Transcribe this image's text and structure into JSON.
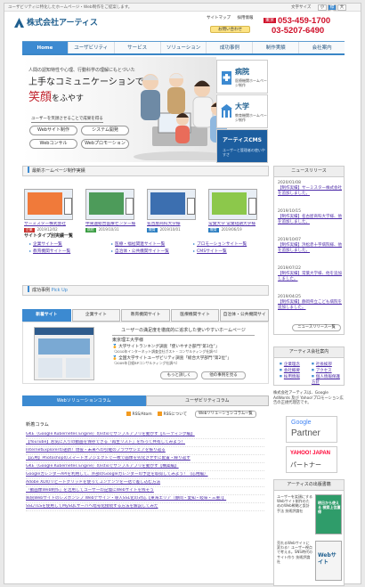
{
  "header": {
    "tagline": "ユーザビリティに特化したホームページ・Web制作をご提案します。",
    "font_size_label": "文字サイズ",
    "font_sizes": [
      "小",
      "標準",
      "大"
    ],
    "logo_text": "株式会社アーティス",
    "links": [
      "サイトマップ",
      "採用情報"
    ],
    "billing_button": "お問い合わせ",
    "tel_tokyo_label": "東京",
    "tel_tokyo": "053-459-1700",
    "tel_other": "03-5207-6490"
  },
  "nav": {
    "items": [
      "Home",
      "ユーザビリティ",
      "サービス",
      "ソリューション",
      "成功事例",
      "制作実績",
      "会社案内"
    ],
    "active": 0
  },
  "hero": {
    "subtitle": "人間の認知特性や心理、行動科学の理解にもとづいた",
    "title_line1": "上手なコミュニケーションで",
    "title_big": "笑顔",
    "title_tail": "をふやす",
    "note": "ユーザーを笑顔させることで成果を得る",
    "buttons": [
      "Webサイト制作",
      "システム開発",
      "Webコンサル",
      "Webプロモーション"
    ]
  },
  "banners": [
    {
      "title": "病院",
      "sub": "医療機関ホームページ制作"
    },
    {
      "title": "大学",
      "sub": "教育機関ホームページ制作"
    },
    {
      "title": "アーティスCMS",
      "sub": "ユーザーと管理者の使いやすさ"
    }
  ],
  "works": {
    "section_title": "最新ホームページ制作実績",
    "items": [
      {
        "name": "サーミスター株式会社",
        "tag": "企業",
        "date": "2019/12/02"
      },
      {
        "name": "中東遠総合医療センター様",
        "tag": "病院",
        "date": "2019/10/31"
      },
      {
        "name": "名古屋商科大学様",
        "tag": "教育",
        "date": "2019/10/01"
      },
      {
        "name": "常葉大学 常葉短期大学様",
        "tag": "教育",
        "date": "2019/06/19"
      }
    ],
    "tag_colors": {
      "企業": "#c9302c",
      "病院": "#3a9d43",
      "教育": "#2d7fc2"
    },
    "kind_title": "サイトタイプ別実績一覧",
    "kinds": [
      "企業サイト一覧",
      "医療・福祉関連サイト一覧",
      "プロモーションサイト一覧",
      "教育機関サイト一覧",
      "自治体・公共機関サイト一覧",
      "CMSサイト一覧"
    ]
  },
  "cases": {
    "section_title": "成功事例",
    "section_sub": "Pick Up",
    "tabs": [
      "新着サイト",
      "企業サイト",
      "教育機関サイト",
      "医療機関サイト",
      "自治体・公共機関サイト"
    ],
    "title": "ユーザーの満足度を徹底的に追求した使いやすいホームページ",
    "client": "東京理工大学様",
    "awards": [
      {
        "text": "大学サイトランキング調査「使いやすさ部門”第1位”」",
        "note": "（2010年インターネット調査会社ガスト・コンサルティング社調べ）"
      },
      {
        "text": "全国大学サイトユーザビリティ調査「総合大学部門”第2位”」",
        "note": "（2009年日経BPコンサルティング社調べ）"
      }
    ],
    "more_button": "もっと詳しく",
    "list_button": "他の事例を見る"
  },
  "solutions": {
    "tabs": [
      "Webソリューションコラム",
      "ユーザビリティコラム"
    ],
    "rss_label": "RSS/Atom",
    "rss_label2": "RSSについて",
    "list_button": "Webソリューションコラム一覧",
    "column_label": "新着コラム",
    "items": [
      "GKE（Google Kubernetes Engine）のistioでサンプルアプリを動かす【ルーティング編】",
      "【YouTube】お気に入りの動画を保存できる「再生リスト」を作って共有してみよう！",
      "InternetExplorerの递新！現役・未来への引継のブラウザシェアを振り返る",
      "【応用】Photoshopのスマートオブジェクトで一枚で画像を劣化させずに配置・繰り返す",
      "GKE（Google Kubernetes Engine）のistioでサンプルアプリを動かす【構築編】",
      "GoogleカレンダーAPIを利用して、外部のGoogleカレンダーの予定を取得してみよう！（応用編）",
      "Adobe XDのリピートグリッドを使ってコンテンツを一括で差し込む方法",
      "「動画像Web制作」を活用してユーザーの記憶にWebサイトを残そう",
      "病院Webサイトのレスポンシブ Webデザイン・導入SSL化の対応【東海エリア（静岡・愛知・岐阜・三重）】",
      "SSL/TLSを使用してMySQLサーバへ暗号化接続する方法を解説してみた"
    ]
  },
  "news": {
    "title": "ニュースリリース",
    "items": [
      {
        "date": "2020/01/08",
        "text": "【制作実績】サーミスター株式会社を追加しました。"
      },
      {
        "date": "2019/10/15",
        "text": "【制作実績】名古屋商科大学様、他を追加しました。"
      },
      {
        "date": "2019/10/07",
        "text": "【制作実績】浜松赤十字病院様、他を追加しました。"
      },
      {
        "date": "2019/07/22",
        "text": "【制作実績】常葉大学様、他を追加しました。"
      },
      {
        "date": "2019/04/25",
        "text": "【制作実績】静岡県立こども病院を追加しました。"
      }
    ],
    "list_button": "ニュースリリース一覧"
  },
  "access": {
    "title": "アーティス会社案内",
    "links": [
      "企業理念",
      "社長挨拶",
      "会社概要",
      "アクセス",
      "採用情報",
      "個人情報保護方針"
    ]
  },
  "partner": {
    "text": "株式会社アーティスは、Google AdWords 及び Yahoo!プロモーション広告の正規代理店です。",
    "google_top": "Google",
    "google_bottom": "Partner",
    "yahoo_top": "YAHOO! JAPAN",
    "yahoo_bottom": "パートナー"
  },
  "books": {
    "title": "アーティスの出版書籍",
    "items": [
      {
        "text": "ユーザーを笑顔にするWebサイト制作のためのWeb戦略と設計手法 技術評論社",
        "cover": "明日から使える 検索上位獲得"
      },
      {
        "text": "売れるWebサイトに変わる！ユーザー視点で考える。SNS時代のサイト作り 技術評論社",
        "cover": "Webサイト"
      }
    ]
  }
}
